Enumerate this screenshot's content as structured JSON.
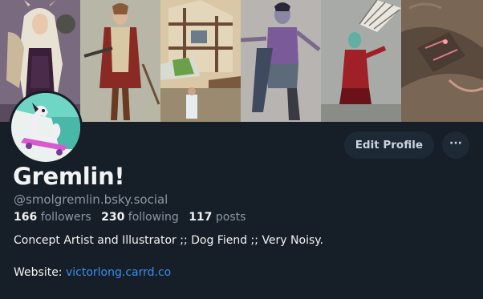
{
  "profile": {
    "display_name": "Gremlin!",
    "handle": "@smolgremlin.bsky.social",
    "followers_count": "166",
    "followers_label": "followers",
    "following_count": "230",
    "following_label": "following",
    "posts_count": "117",
    "posts_label": "posts",
    "bio": "Concept Artist and Illustrator ;; Dog Fiend ;; Very Noisy.",
    "website_label": "Website:",
    "website_url": "victorlong.carrd.co"
  },
  "actions": {
    "edit_profile": "Edit Profile",
    "more": "···"
  },
  "banner": {
    "panels": [
      "elf-mage-artwork",
      "adventurer-artwork",
      "timber-house-artwork",
      "purple-warrior-artwork",
      "red-alien-artwork",
      "dragon-artwork"
    ]
  },
  "colors": {
    "background": "#161e27",
    "button_bg": "#1e2936",
    "link": "#3a8cf0",
    "muted_text": "#8b98a5",
    "primary_text": "#f1f3f5"
  }
}
